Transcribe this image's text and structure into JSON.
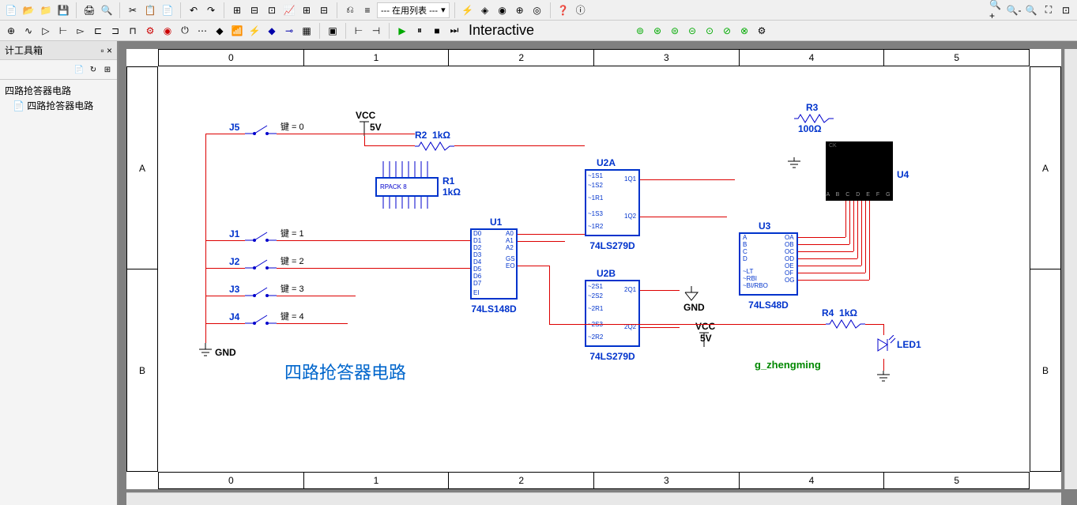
{
  "toolbar1": {
    "dropdown_label": "--- 在用列表 ---"
  },
  "toolbar2": {
    "sim_mode": "Interactive"
  },
  "panel": {
    "title": "计工具箱",
    "project": "四路抢答器电路",
    "sheet": "四路抢答器电路"
  },
  "ruler": {
    "cols": [
      "0",
      "1",
      "2",
      "3",
      "4",
      "5"
    ],
    "rows": [
      "A",
      "B"
    ]
  },
  "components": {
    "J5": {
      "ref": "J5",
      "key": "键 = 0"
    },
    "J1": {
      "ref": "J1",
      "key": "键 = 1"
    },
    "J2": {
      "ref": "J2",
      "key": "键 = 2"
    },
    "J3": {
      "ref": "J3",
      "key": "键 = 3"
    },
    "J4": {
      "ref": "J4",
      "key": "键 = 4"
    },
    "VCC": "VCC",
    "VCC_val": "5V",
    "VCC2_val": "5V",
    "GND": "GND",
    "GND2": "GND",
    "R1": {
      "ref": "R1",
      "val": "1kΩ",
      "type": "RPACK 8"
    },
    "R2": {
      "ref": "R2",
      "val": "1kΩ"
    },
    "R3": {
      "ref": "R3",
      "val": "100Ω"
    },
    "R4": {
      "ref": "R4",
      "val": "1kΩ"
    },
    "U1": {
      "ref": "U1",
      "part": "74LS148D"
    },
    "U2A": {
      "ref": "U2A",
      "part": "74LS279D"
    },
    "U2B": {
      "ref": "U2B",
      "part": "74LS279D"
    },
    "U3": {
      "ref": "U3",
      "part": "74LS48D"
    },
    "U4": {
      "ref": "U4"
    },
    "LED1": "LED1",
    "title": "四路抢答器电路",
    "author": "g_zhengming"
  },
  "pins": {
    "U1_left": [
      "D0",
      "D1",
      "D2",
      "D3",
      "D4",
      "D5",
      "D6",
      "D7",
      "EI"
    ],
    "U1_right": [
      "A0",
      "A1",
      "A2",
      "GS",
      "EO"
    ],
    "U2A_left": [
      "~1S1",
      "~1S2",
      "~1R1",
      "~1S3",
      "~1R2"
    ],
    "U2A_right_1": "1Q1",
    "U2A_right_2": "1Q2",
    "U2B_left": [
      "~2S1",
      "~2S2",
      "~2R1",
      "~2S3",
      "~2R2"
    ],
    "U2B_right_1": "2Q1",
    "U2B_right_2": "2Q2",
    "U3_left": [
      "A",
      "B",
      "C",
      "D",
      "~LT",
      "~RBI",
      "~BI/RBO"
    ],
    "U3_right": [
      "OA",
      "OB",
      "OC",
      "OD",
      "OE",
      "OF",
      "OG"
    ],
    "U4_seg": "A B C D E F G"
  }
}
